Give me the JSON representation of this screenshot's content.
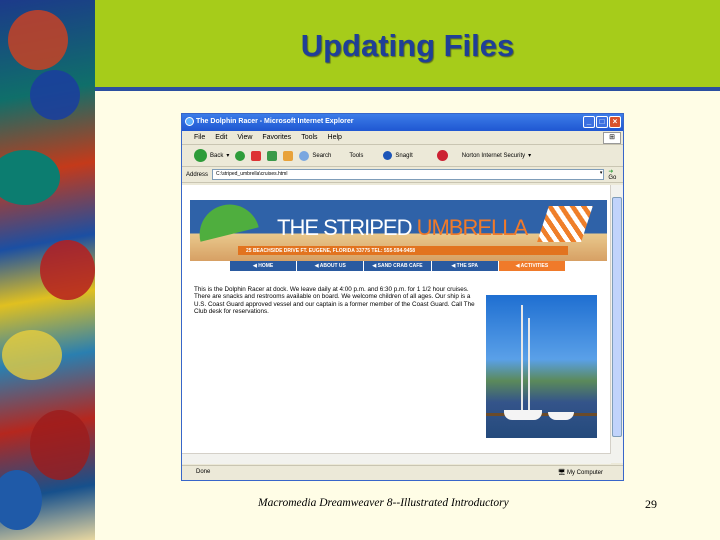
{
  "slide": {
    "title": "Updating Files",
    "footer": "Macromedia Dreamweaver 8--Illustrated Introductory",
    "page_number": "29",
    "colors": {
      "title_band": "#a6cc1a",
      "title_text": "#1f3f97",
      "background": "#fffde6",
      "divider": "#2b4fa0"
    }
  },
  "browser": {
    "window_title": "The Dolphin Racer - Microsoft Internet Explorer",
    "menu": [
      "File",
      "Edit",
      "View",
      "Favorites",
      "Tools",
      "Help"
    ],
    "toolbar": {
      "back": "Back",
      "search": "Search",
      "favorites": "Tools",
      "snagit": "SnagIt",
      "security": "Norton Internet Security"
    },
    "address_label": "Address",
    "address_value": "C:\\striped_umbrella\\cruises.html",
    "go_label": "Go",
    "status_left": "Done",
    "status_zone": "My Computer"
  },
  "site": {
    "logo_prefix": "THE STRIPED ",
    "logo_highlight": "UMBRELLA",
    "address_line": "25 BEACHSIDE DRIVE   FT. EUGENE, FLORIDA 33775   TEL: 555-594-9458",
    "nav": [
      {
        "label": "◀ HOME",
        "active": false
      },
      {
        "label": "◀ ABOUT US",
        "active": false
      },
      {
        "label": "◀ SAND CRAB CAFE",
        "active": false
      },
      {
        "label": "◀ THE SPA",
        "active": false
      },
      {
        "label": "◀ ACTIVITIES",
        "active": true
      }
    ],
    "paragraph": "This is the Dolphin Racer at dock. We leave daily at 4:00 p.m. and 6:30 p.m. for 1 1/2 hour cruises. There are snacks and restrooms available on board. We welcome children of all ages. Our ship is a U.S. Coast Guard approved vessel and our captain is a former member of the Coast Guard. Call The Club desk for reservations."
  }
}
